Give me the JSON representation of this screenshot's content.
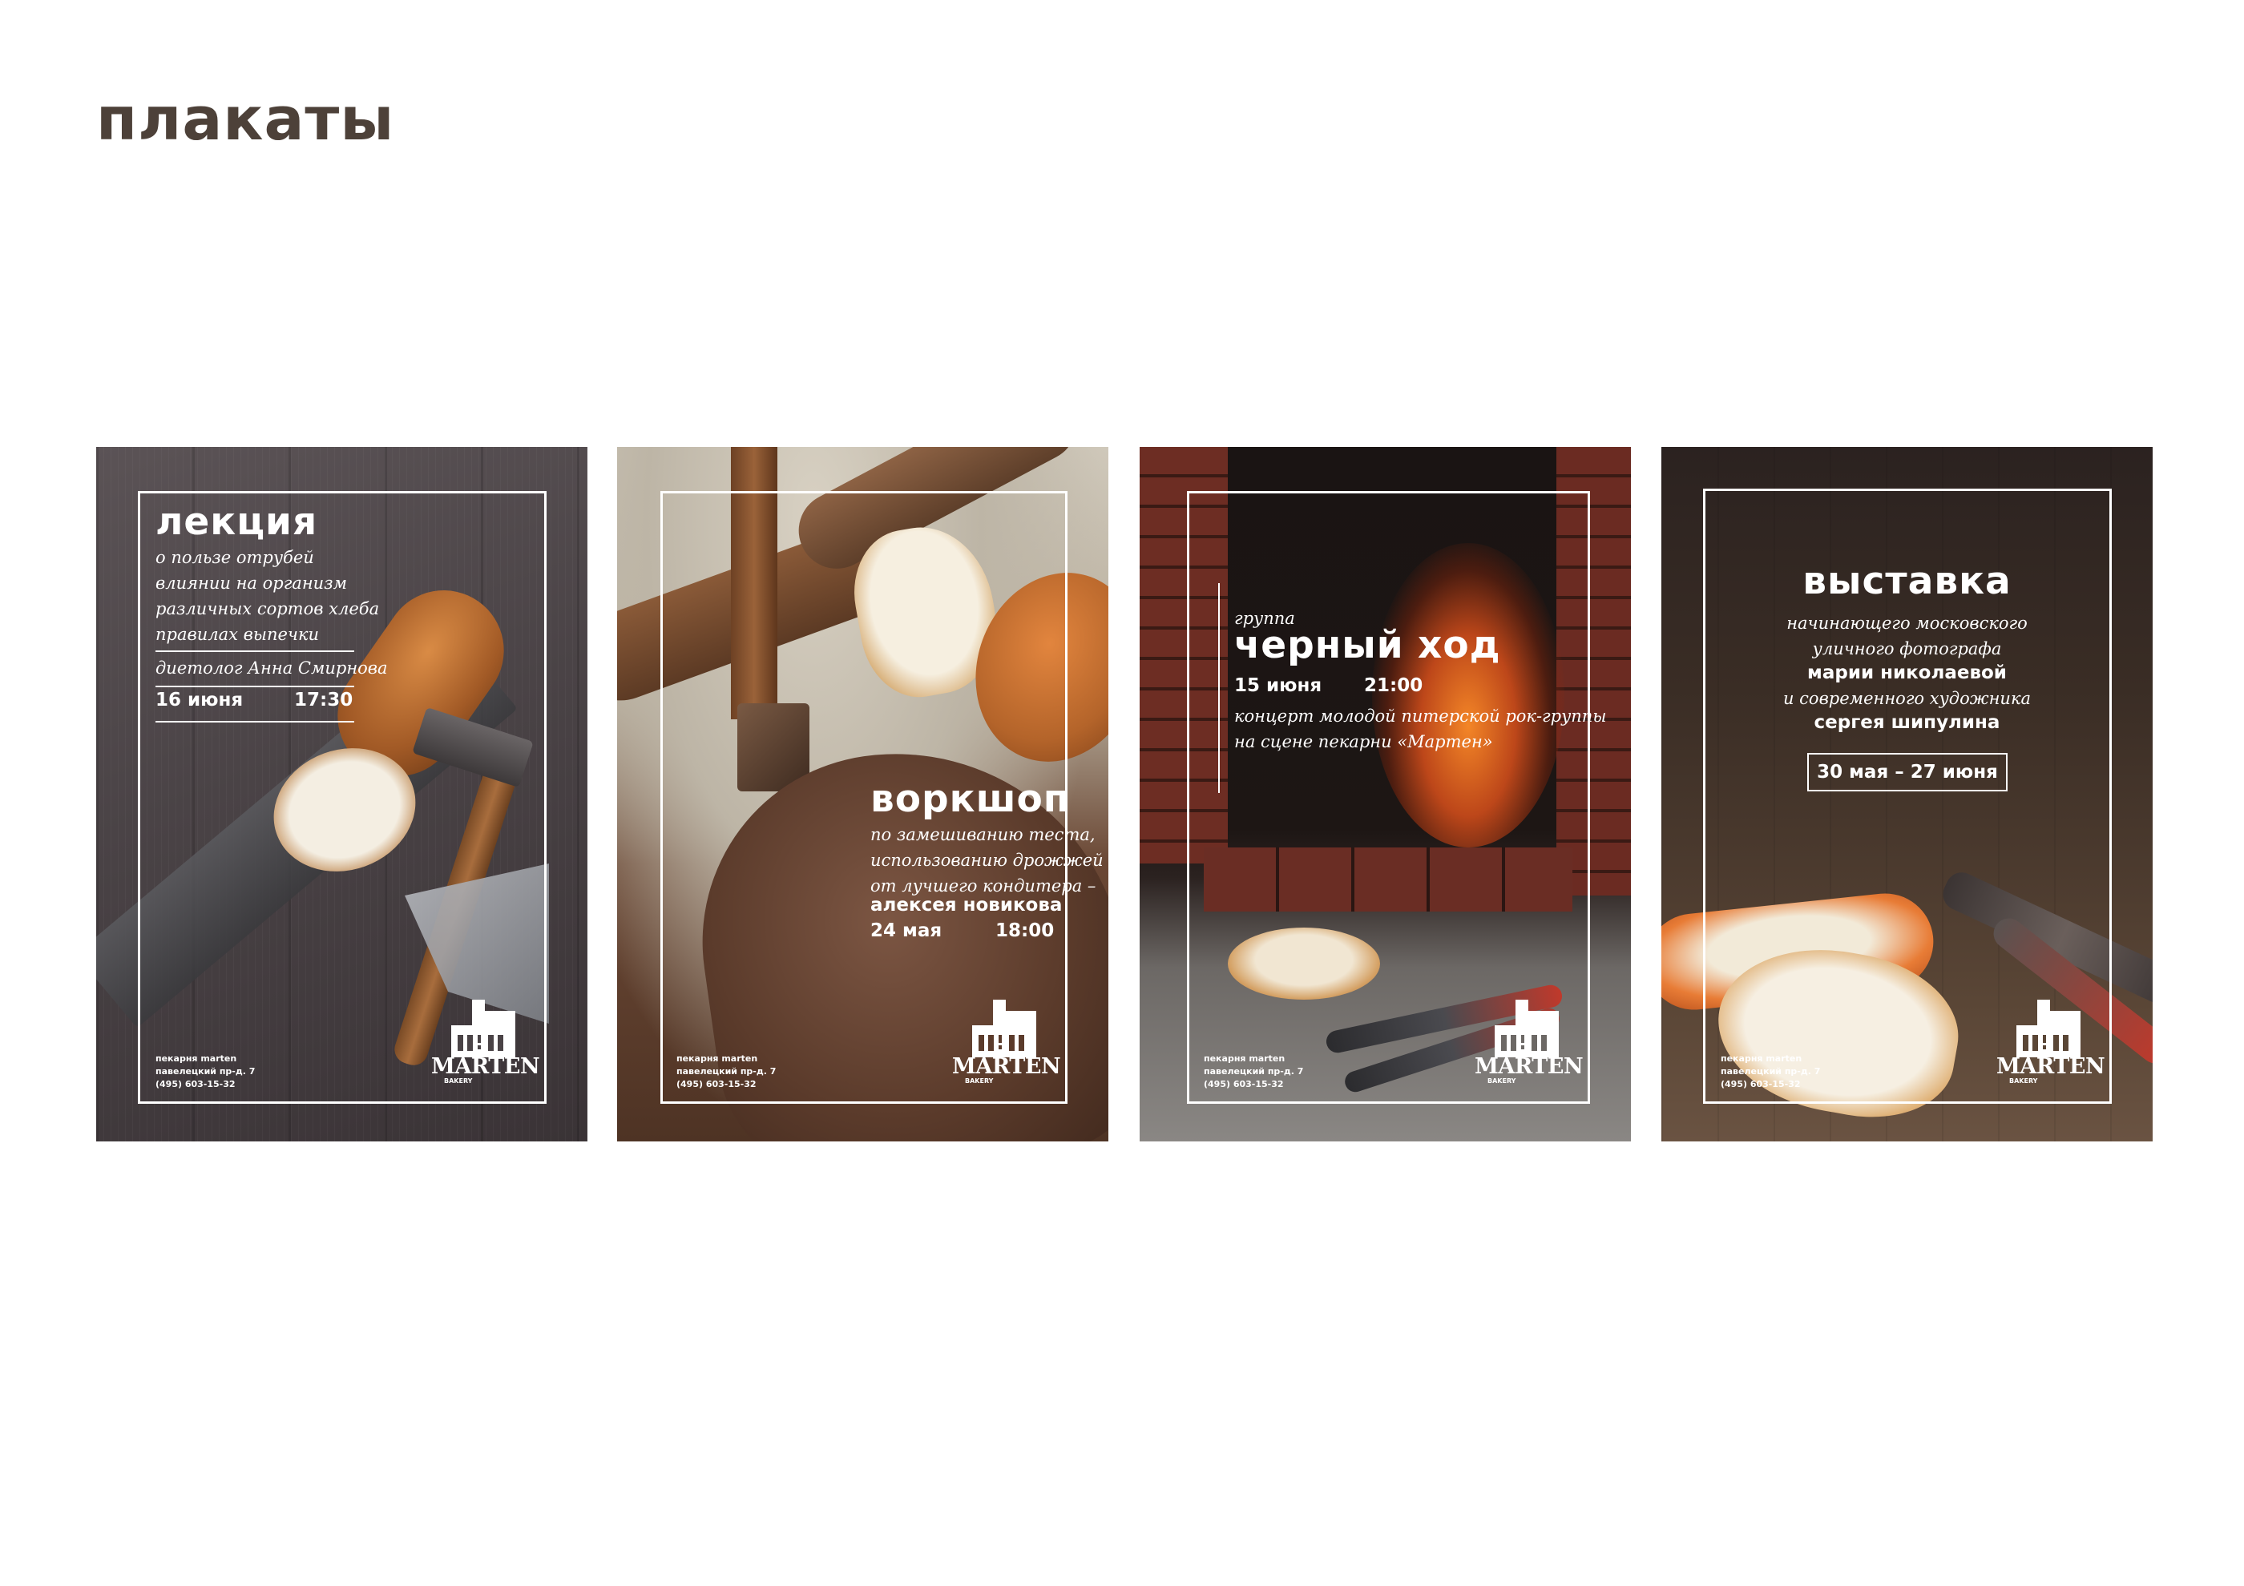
{
  "page": {
    "title": "плакаты"
  },
  "posters": [
    {
      "heading": "лекция",
      "description": [
        "о пользе отрубей",
        "влиянии на организм",
        "различных сортов хлеба",
        "правилах выпечки"
      ],
      "speaker": "диетолог Анна Смирнова",
      "date": "16 июня",
      "time": "17:30",
      "contacts": [
        "пекарня marten",
        "павелецкий пр-д. 7",
        "(495) 603-15-32"
      ],
      "logo": {
        "word": "MARTEN",
        "sub": "BAKERY"
      }
    },
    {
      "heading": "воркшоп",
      "description": [
        "по замешиванию теста,",
        "использованию дрожжей",
        "от лучшего кондитера –"
      ],
      "speaker": "алексея новикова",
      "date": "24 мая",
      "time": "18:00",
      "contacts": [
        "пекарня marten",
        "павелецкий пр-д. 7",
        "(495) 603-15-32"
      ],
      "logo": {
        "word": "MARTEN",
        "sub": "BAKERY"
      }
    },
    {
      "kicker": "группа",
      "heading": "черный ход",
      "date": "15 июня",
      "time": "21:00",
      "description": [
        "концерт молодой питерской рок-группы",
        "на сцене пекарни «Мартен»"
      ],
      "contacts": [
        "пекарня marten",
        "павелецкий пр-д. 7",
        "(495) 603-15-32"
      ],
      "logo": {
        "word": "MARTEN",
        "sub": "BAKERY"
      }
    },
    {
      "heading": "выставка",
      "line1": "начинающего московского",
      "line2": "уличного фотографа",
      "name1": "марии николаевой",
      "line3": "и современного художника",
      "name2": "сергея шипулина",
      "dates": "30 мая – 27 июня",
      "contacts": [
        "пекарня marten",
        "павелецкий пр-д. 7",
        "(495) 603-15-32"
      ],
      "logo": {
        "word": "MARTEN",
        "sub": "BAKERY"
      }
    }
  ],
  "colors": {
    "title": "#4d4139",
    "poster_text": "#ffffff",
    "wood_dark": "#3c3530",
    "fire_orange": "#e5531b",
    "bread_crust": "#b4642a"
  }
}
